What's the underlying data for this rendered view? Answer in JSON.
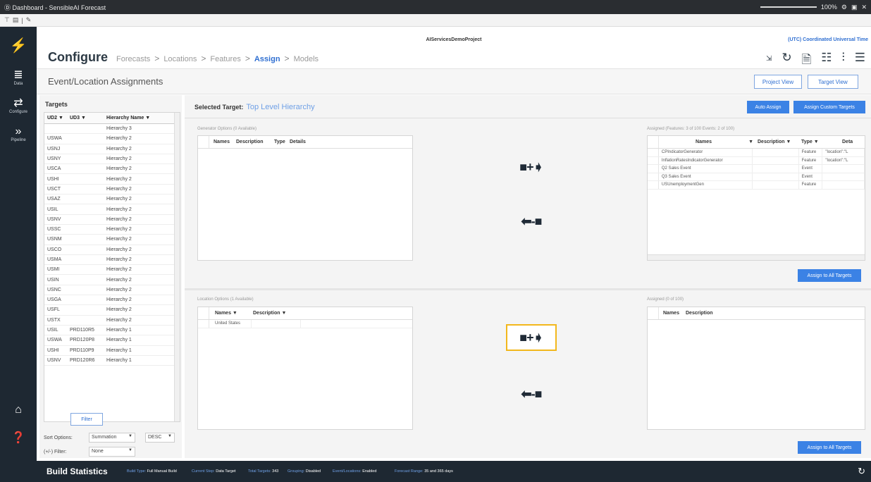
{
  "window": {
    "title": "Ⓓ Dashboard - SensibleAI Forecast",
    "zoom": "100%"
  },
  "toolstrip": {
    "items": [
      "T",
      "B",
      "|",
      "✎"
    ]
  },
  "nav": {
    "items": [
      {
        "icon": "logo-icon",
        "glyph": "✗",
        "label": ""
      },
      {
        "icon": "data-icon",
        "glyph": "≣",
        "label": "Data"
      },
      {
        "icon": "configure-icon",
        "glyph": "⇌",
        "label": "Configure"
      },
      {
        "icon": "pipeline-icon",
        "glyph": "»»",
        "label": "Pipeline"
      }
    ],
    "bottom": [
      {
        "icon": "home-icon",
        "glyph": "⌂"
      },
      {
        "icon": "help-icon",
        "glyph": "?"
      },
      {
        "icon": "users-icon",
        "glyph": "☍"
      }
    ]
  },
  "header": {
    "project": "AIServicesDemoProject",
    "timezone": "(UTC) Coordinated Universal Time",
    "breadcrumb": {
      "main": "Configure",
      "steps": [
        "Forecasts",
        "Locations",
        "Features",
        "Assign",
        "Models"
      ],
      "active": "Assign"
    },
    "icons": [
      "undo-icon",
      "refresh-icon",
      "document-icon",
      "table-icon",
      "chart-icon",
      "database-icon"
    ]
  },
  "page": {
    "title": "Event/Location Assignments",
    "project_view": "Project View",
    "target_view": "Target View"
  },
  "targets": {
    "title": "Targets",
    "columns": [
      "UD2",
      "UD3",
      "Hierarchy Name"
    ],
    "rows": [
      [
        "",
        "",
        "Hierarchy 3"
      ],
      [
        "USWA",
        "",
        "Hierarchy 2"
      ],
      [
        "USNJ",
        "",
        "Hierarchy 2"
      ],
      [
        "USNY",
        "",
        "Hierarchy 2"
      ],
      [
        "USCA",
        "",
        "Hierarchy 2"
      ],
      [
        "USHI",
        "",
        "Hierarchy 2"
      ],
      [
        "USCT",
        "",
        "Hierarchy 2"
      ],
      [
        "USAZ",
        "",
        "Hierarchy 2"
      ],
      [
        "USIL",
        "",
        "Hierarchy 2"
      ],
      [
        "USNV",
        "",
        "Hierarchy 2"
      ],
      [
        "USSC",
        "",
        "Hierarchy 2"
      ],
      [
        "USNM",
        "",
        "Hierarchy 2"
      ],
      [
        "USCO",
        "",
        "Hierarchy 2"
      ],
      [
        "USMA",
        "",
        "Hierarchy 2"
      ],
      [
        "USMI",
        "",
        "Hierarchy 2"
      ],
      [
        "USIN",
        "",
        "Hierarchy 2"
      ],
      [
        "USNC",
        "",
        "Hierarchy 2"
      ],
      [
        "USGA",
        "",
        "Hierarchy 2"
      ],
      [
        "USFL",
        "",
        "Hierarchy 2"
      ],
      [
        "USTX",
        "",
        "Hierarchy 2"
      ],
      [
        "USIL",
        "PRD110R5",
        "Hierarchy 1"
      ],
      [
        "USWA",
        "PRD120P8",
        "Hierarchy 1"
      ],
      [
        "USHI",
        "PRD110P9",
        "Hierarchy 1"
      ],
      [
        "USNV",
        "PRD120R6",
        "Hierarchy 1"
      ]
    ],
    "filter_label": "Filter",
    "sort_label": "Sort Options:",
    "sort_value": "Summation",
    "sort_dir": "DESC",
    "pm_filter_label": "(+/-) Filter:",
    "pm_filter_value": "None"
  },
  "main": {
    "selected_label": "Selected Target:",
    "selected_value": "Top Level Hierarchy",
    "auto_assign": "Auto Assign",
    "assign_custom": "Assign Custom Targets",
    "generator_label": "Generator Options (0 Available)",
    "generator_cols": [
      "Names",
      "Description",
      "Type",
      "Details"
    ],
    "assigned_features_label": "Assigned (Features: 3 of 100 Events: 2 of 100)",
    "assigned_cols": [
      "Names",
      "Description",
      "Type",
      "Deta"
    ],
    "assigned_rows": [
      [
        "CPIndicatorGenerator",
        "",
        "Feature",
        "\"location\":\"L"
      ],
      [
        "InflationRatesIndicatorGenerator",
        "",
        "Feature",
        "\"location\":\"L"
      ],
      [
        "Q2 Sales Event",
        "",
        "Event",
        ""
      ],
      [
        "Q3 Sales Event",
        "",
        "Event",
        ""
      ],
      [
        "USUnemploymentGen",
        "",
        "Feature",
        ""
      ]
    ],
    "assign_all_1": "Assign to All Targets",
    "location_label": "Location Options (1 Available)",
    "location_cols": [
      "Names",
      "Description"
    ],
    "location_rows": [
      [
        "United States",
        ""
      ]
    ],
    "assigned_loc_label": "Assigned (0 of 100)",
    "assigned_loc_cols": [
      "Names",
      "Description"
    ],
    "assign_all_2": "Assign to All Targets",
    "add_glyph": "■+➧",
    "remove_glyph": "⬅-■"
  },
  "status": {
    "title": "Build Statistics",
    "items": [
      {
        "k": "Build Type:",
        "v": "Full Manual Build"
      },
      {
        "k": "Current Step:",
        "v": "Data Target"
      },
      {
        "k": "Total Targets:",
        "v": "343"
      },
      {
        "k": "Grouping:",
        "v": "Disabled"
      },
      {
        "k": "Event/Locations:",
        "v": "Enabled"
      },
      {
        "k": "Forecast Range:",
        "v": "35 and 365 days"
      }
    ]
  }
}
